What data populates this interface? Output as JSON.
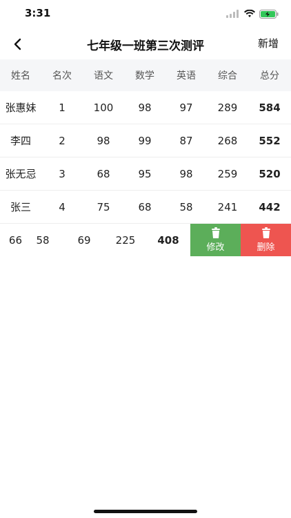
{
  "status_bar": {
    "time": "3:31",
    "icons": [
      "signal-icon",
      "wifi-icon",
      "battery-charging-icon"
    ]
  },
  "nav": {
    "title": "七年级一班第三次测评",
    "action_label": "新增",
    "back_icon": "chevron-left-icon"
  },
  "table": {
    "headers": [
      "姓名",
      "名次",
      "语文",
      "数学",
      "英语",
      "综合",
      "总分"
    ],
    "rows": [
      {
        "name": "张惠妹",
        "rank": "1",
        "chinese": "100",
        "math": "98",
        "english": "97",
        "comprehensive": "289",
        "total": "584"
      },
      {
        "name": "李四",
        "rank": "2",
        "chinese": "98",
        "math": "99",
        "english": "87",
        "comprehensive": "268",
        "total": "552"
      },
      {
        "name": "张无忌",
        "rank": "3",
        "chinese": "68",
        "math": "95",
        "english": "98",
        "comprehensive": "259",
        "total": "520"
      },
      {
        "name": "张三",
        "rank": "4",
        "chinese": "75",
        "math": "68",
        "english": "58",
        "comprehensive": "241",
        "total": "442"
      }
    ],
    "swiped_row": {
      "partial_value": "66",
      "math": "58",
      "english": "69",
      "comprehensive": "225",
      "total": "408",
      "edit_label": "修改",
      "delete_label": "删除"
    }
  },
  "colors": {
    "edit": "#5cae5a",
    "delete": "#ee5550",
    "header_bg": "#f5f6f8"
  }
}
